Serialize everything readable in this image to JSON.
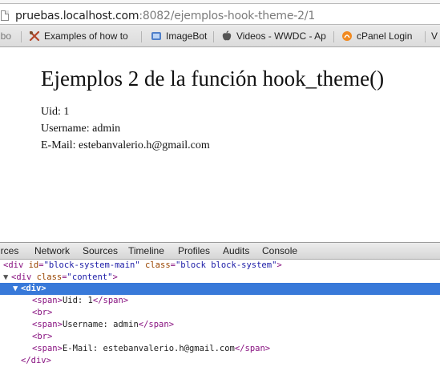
{
  "browser": {
    "url_host": "pruebas.localhost.com",
    "url_rest": ":8082/ejemplos-hook-theme-2/1",
    "bookmarks": {
      "first": "nbo",
      "items": [
        "Examples of how to",
        "ImageBot",
        "Videos - WWDC - Ap",
        "cPanel Login"
      ],
      "last": "V"
    }
  },
  "page": {
    "title": "Ejemplos 2 de la función hook_theme()",
    "uid_line": "Uid: 1",
    "username_line": "Username: admin",
    "email_line": "E-Mail: estebanvalerio.h@gmail.com"
  },
  "devtools": {
    "tabs": [
      "urces",
      "Network",
      "Sources",
      "Timeline",
      "Profiles",
      "Audits",
      "Console"
    ],
    "tree": {
      "r0_tag_open": "<div ",
      "r0_attr1_name": "id",
      "r0_attr1_val": "\"block-system-main\"",
      "r0_attr2_name": "class",
      "r0_attr2_val": "\"block block-system\"",
      "r0_tag_close": ">",
      "r1_tag_open": "<div ",
      "r1_attr_name": "class",
      "r1_attr_val": "\"content\"",
      "r1_tag_close": ">",
      "r2_tag": "<div>",
      "r3_open": "<span>",
      "r3_text": "Uid: 1",
      "r3_close": "</span>",
      "r4_tag": "<br>",
      "r5_open": "<span>",
      "r5_text": "Username: admin",
      "r5_close": "</span>",
      "r6_tag": "<br>",
      "r7_open": "<span>",
      "r7_text": "E-Mail: estebanvalerio.h@gmail.com",
      "r7_close": "</span>",
      "r8_tag": "</div>"
    }
  },
  "colors": {
    "selection": "#3879d9",
    "tag": "#881280",
    "attr_name": "#994500",
    "attr_value": "#1a1aa6"
  },
  "icons": {
    "page": "page-icon",
    "bookmark_1": "tools-icon",
    "bookmark_2": "imagebot-icon",
    "bookmark_3": "apple-icon",
    "bookmark_4": "cpanel-icon"
  }
}
